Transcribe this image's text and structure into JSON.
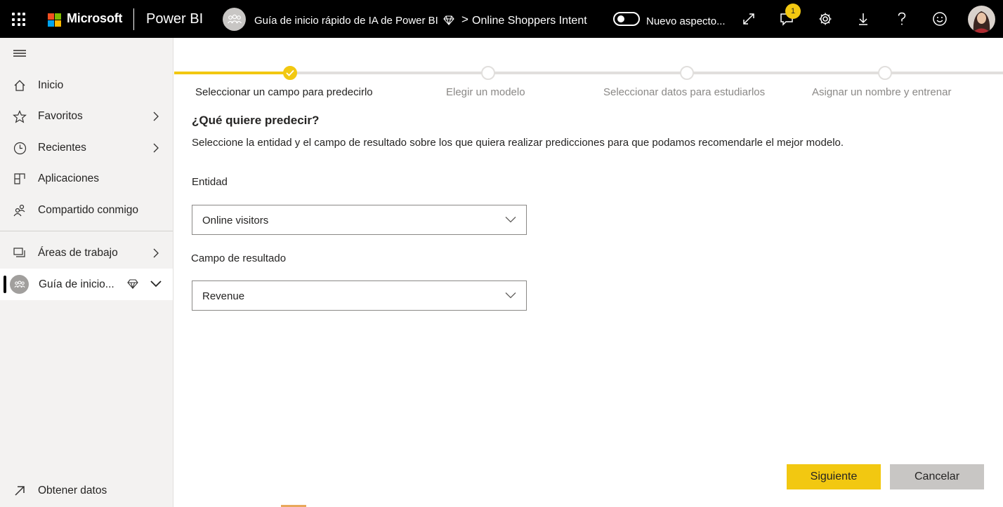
{
  "topbar": {
    "brand": "Microsoft",
    "product": "Power BI",
    "breadcrumb_workspace": "Guía de inicio rápido de IA de Power BI",
    "breadcrumb_separator": ">",
    "breadcrumb_report": "Online Shoppers Intent",
    "new_look_label": "Nuevo aspecto...",
    "notification_count": "1",
    "icons": [
      "waffle-icon",
      "expand-icon",
      "notifications-icon",
      "settings-icon",
      "download-icon",
      "help-icon",
      "feedback-icon"
    ]
  },
  "sidebar": {
    "items": [
      {
        "label": "Inicio",
        "icon": "home-icon"
      },
      {
        "label": "Favoritos",
        "icon": "star-icon"
      },
      {
        "label": "Recientes",
        "icon": "clock-icon"
      },
      {
        "label": "Aplicaciones",
        "icon": "apps-icon"
      },
      {
        "label": "Compartido conmigo",
        "icon": "shared-icon"
      },
      {
        "label": "Áreas de trabajo",
        "icon": "workspaces-icon"
      }
    ],
    "active_workspace": "Guía de inicio...",
    "get_data": "Obtener datos"
  },
  "wizard": {
    "steps": [
      {
        "label": "Seleccionar un campo para predecirlo",
        "state": "completed"
      },
      {
        "label": "Elegir un modelo",
        "state": "pending"
      },
      {
        "label": "Seleccionar datos para estudiarlos",
        "state": "pending"
      },
      {
        "label": "Asignar un nombre y entrenar",
        "state": "pending"
      }
    ],
    "title": "¿Qué quiere predecir?",
    "description": "Seleccione la entidad y el campo de resultado sobre los que quiera realizar predicciones para que podamos recomendarle el mejor modelo.",
    "entity_label": "Entidad",
    "entity_value": "Online visitors",
    "outcome_label": "Campo de resultado",
    "outcome_value": "Revenue",
    "next_button": "Siguiente",
    "cancel_button": "Cancelar"
  },
  "colors": {
    "accent": "#f2c811",
    "topbar": "#000000",
    "sidebar": "#f3f2f1",
    "cancel": "#c8c6c4"
  }
}
